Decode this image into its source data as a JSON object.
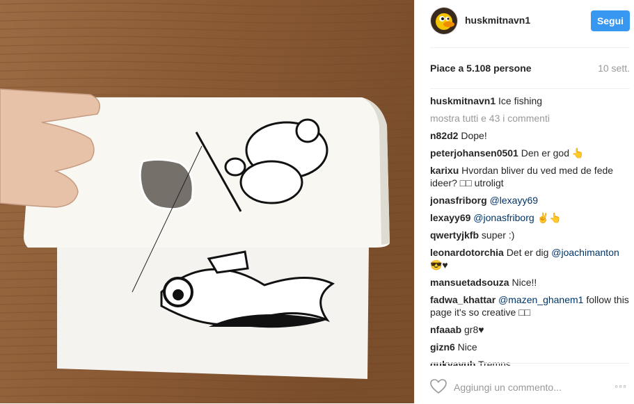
{
  "post": {
    "username": "huskmitnavn1",
    "follow_label": "Segui",
    "likes_text": "Piace a 5.108 persone",
    "date": "10 sett.",
    "caption_user": "huskmitnavn1",
    "caption_text": "Ice fishing",
    "show_all": "mostra tutti e 43 i commenti",
    "add_comment_placeholder": "Aggiungi un commento...",
    "more_options": "◦◦◦"
  },
  "comments": [
    {
      "user": "n82d2",
      "text": "Dope!"
    },
    {
      "user": "peterjohansen0501",
      "text": "Den er god 👆"
    },
    {
      "user": "karixu",
      "text": "Hvordan bliver du ved med de fede ideer? □□ utroligt"
    },
    {
      "user": "jonasfriborg",
      "mention": "@lexayy69",
      "text": ""
    },
    {
      "user": "lexayy69",
      "mention": "@jonasfriborg",
      "text": " ✌👆"
    },
    {
      "user": "qwertyjkfb",
      "text": "super :)"
    },
    {
      "user": "leonardotorchia",
      "text": "Det er dig ",
      "mention": "@joachimanton",
      "after": " 😎♥"
    },
    {
      "user": "mansuetadsouza",
      "text": "Nice!!"
    },
    {
      "user": "fadwa_khattar",
      "mention": "@mazen_ghanem1",
      "after": " follow this page it's so creative □□"
    },
    {
      "user": "nfaaab",
      "text": "gr8♥"
    },
    {
      "user": "gizn6",
      "text": "Nice"
    },
    {
      "user": "gukyayub",
      "text": "Tremns"
    }
  ],
  "colors": {
    "accent": "#3897f0",
    "table": "#8a5a34",
    "paper": "#f6f4ee"
  }
}
